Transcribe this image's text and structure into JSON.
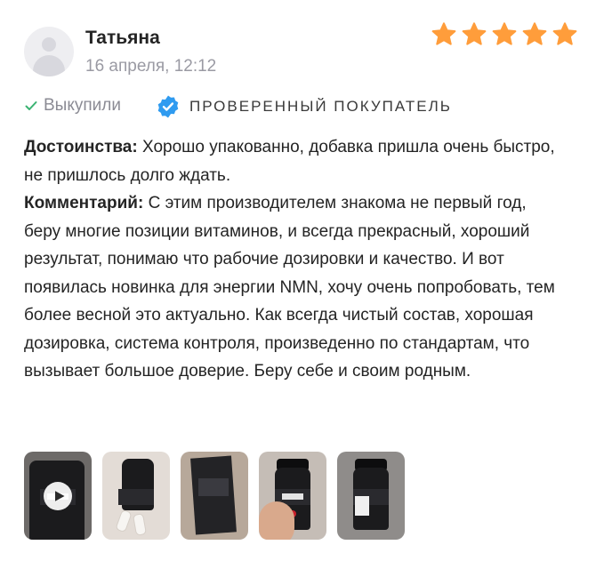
{
  "review": {
    "author": "Татьяна",
    "date": "16 апреля, 12:12",
    "rating": 5,
    "purchased_label": "Выкупили",
    "verified_label": "ПРОВЕРЕННЫЙ ПОКУПАТЕЛЬ",
    "advantages_label": "Достоинства:",
    "advantages_text": "Хорошо упакованно, добавка пришла очень быстро, не пришлось долго ждать.",
    "comment_label": "Комментарий:",
    "comment_text": "С этим производителем знакома не первый год, беру многие позиции витаминов, и всегда прекрасный, хороший результат, понимаю что рабочие дозировки и качество. И вот появилась новинка для энергии NMN, хочу очень попробовать, тем более весной это актуально. Как всегда чистый состав, хорошая дозировка, система контроля, произведенно по стандартам, что вызывает большое доверие. Беру себе и своим родным."
  },
  "colors": {
    "star": "#ff9d3b",
    "check": "#3ab372",
    "verified_badge": "#2f9bf0",
    "muted_text": "#9a9aa3"
  },
  "icons": {
    "avatar": "user-avatar-placeholder",
    "star": "star-icon",
    "check": "check-icon",
    "verified": "verified-badge-icon",
    "play": "play-icon"
  }
}
